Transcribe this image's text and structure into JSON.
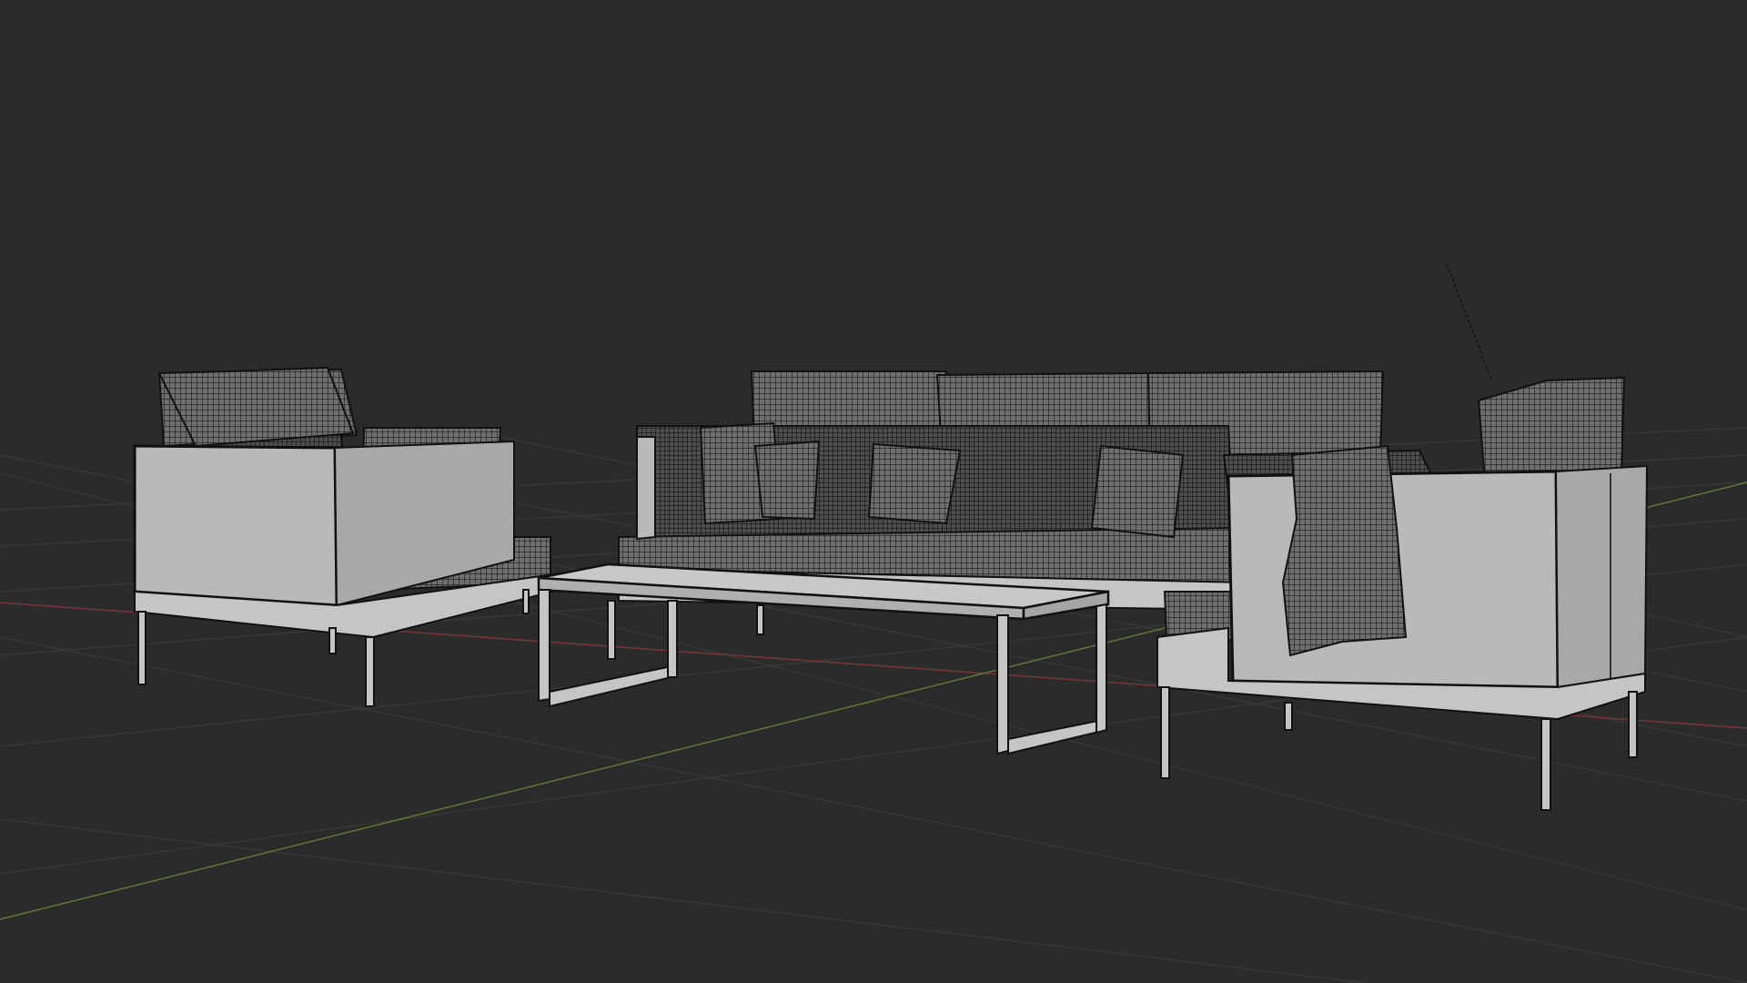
{
  "viewport": {
    "background_color": "#2b2b2b",
    "grid_line_color": "#3a3a3a",
    "axis_x_color": "#8a3a3a",
    "axis_y_color": "#6a8a3a",
    "mesh_fill_color": "#b9b9b9",
    "mesh_edge_color": "#111111",
    "wire_dense_color": "#7f7f7f"
  },
  "scene_objects": [
    "armchair-left",
    "sofa",
    "coffee-table",
    "armchair-right",
    "throw-blanket",
    "cushions"
  ]
}
